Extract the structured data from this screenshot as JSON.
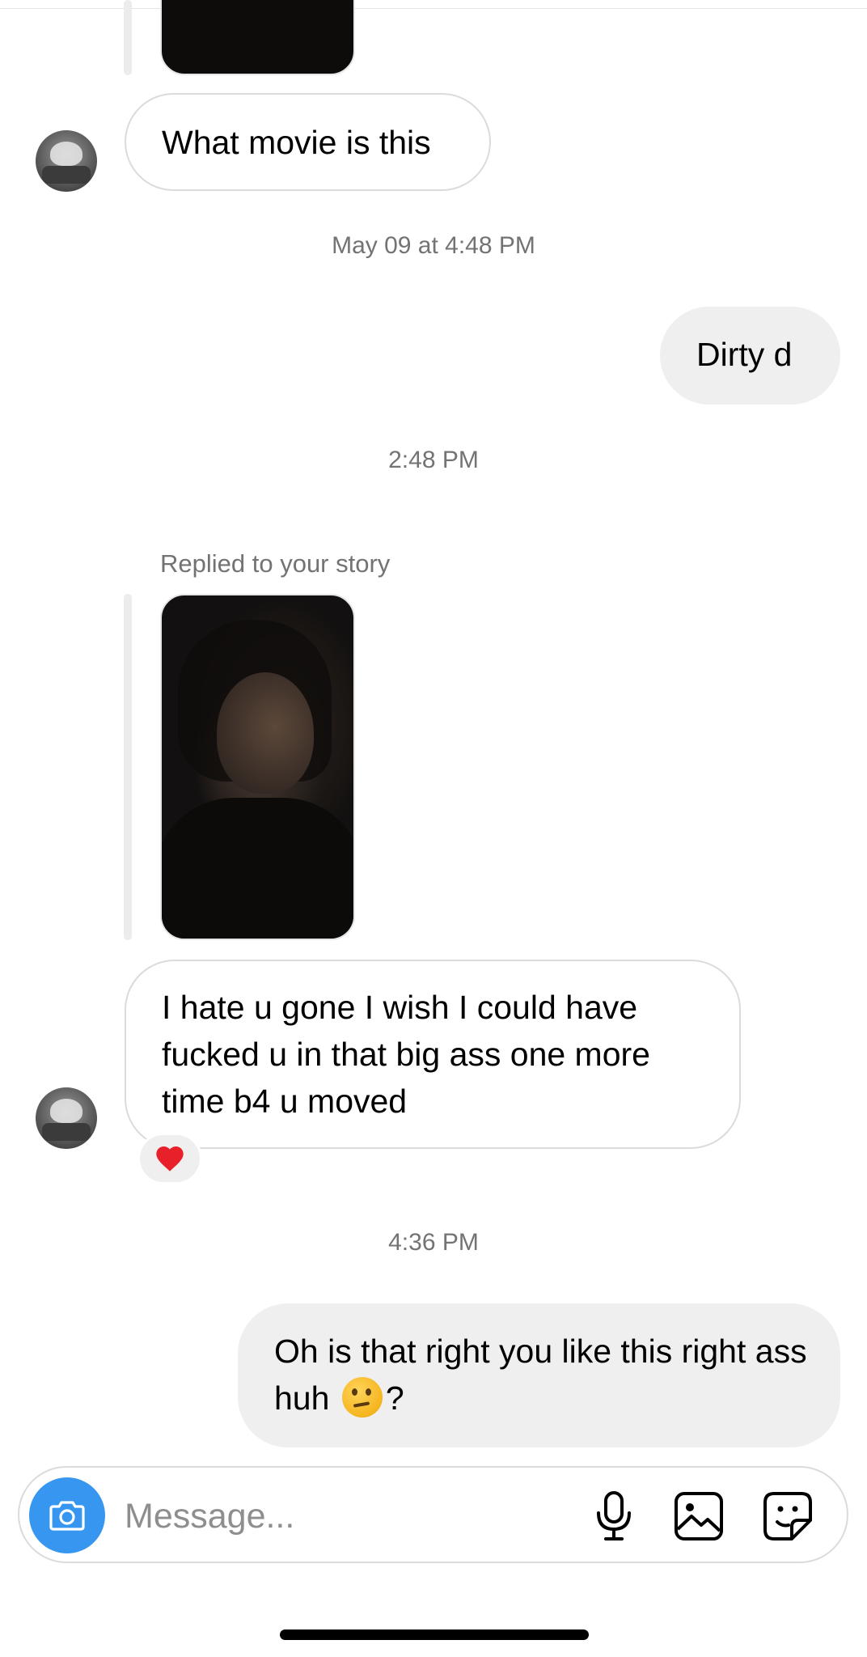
{
  "thread": {
    "messages": [
      {
        "sender": "them",
        "text": "What movie is this"
      },
      {
        "sender": "me",
        "text": "Dirty d"
      },
      {
        "sender": "them",
        "text": "I hate u gone I wish I could have fucked u in that big ass one more time b4 u moved",
        "reaction": "❤️"
      },
      {
        "sender": "me",
        "text_before": "Oh is that right you like this right ass huh",
        "emoji": "🤔",
        "text_after": "?"
      }
    ],
    "timestamps": [
      "May 09 at 4:48 PM",
      "2:48 PM",
      "4:36 PM"
    ],
    "story_reply_label": "Replied to your story"
  },
  "composer": {
    "placeholder": "Message..."
  },
  "icons": {
    "camera": "camera-icon",
    "mic": "microphone-icon",
    "gallery": "gallery-icon",
    "sticker": "sticker-icon",
    "reaction": "heart-icon"
  },
  "colors": {
    "accent": "#3797f0",
    "outgoing_bubble": "#efefef",
    "incoming_border": "#dbdbdb",
    "meta_text": "#737373"
  }
}
